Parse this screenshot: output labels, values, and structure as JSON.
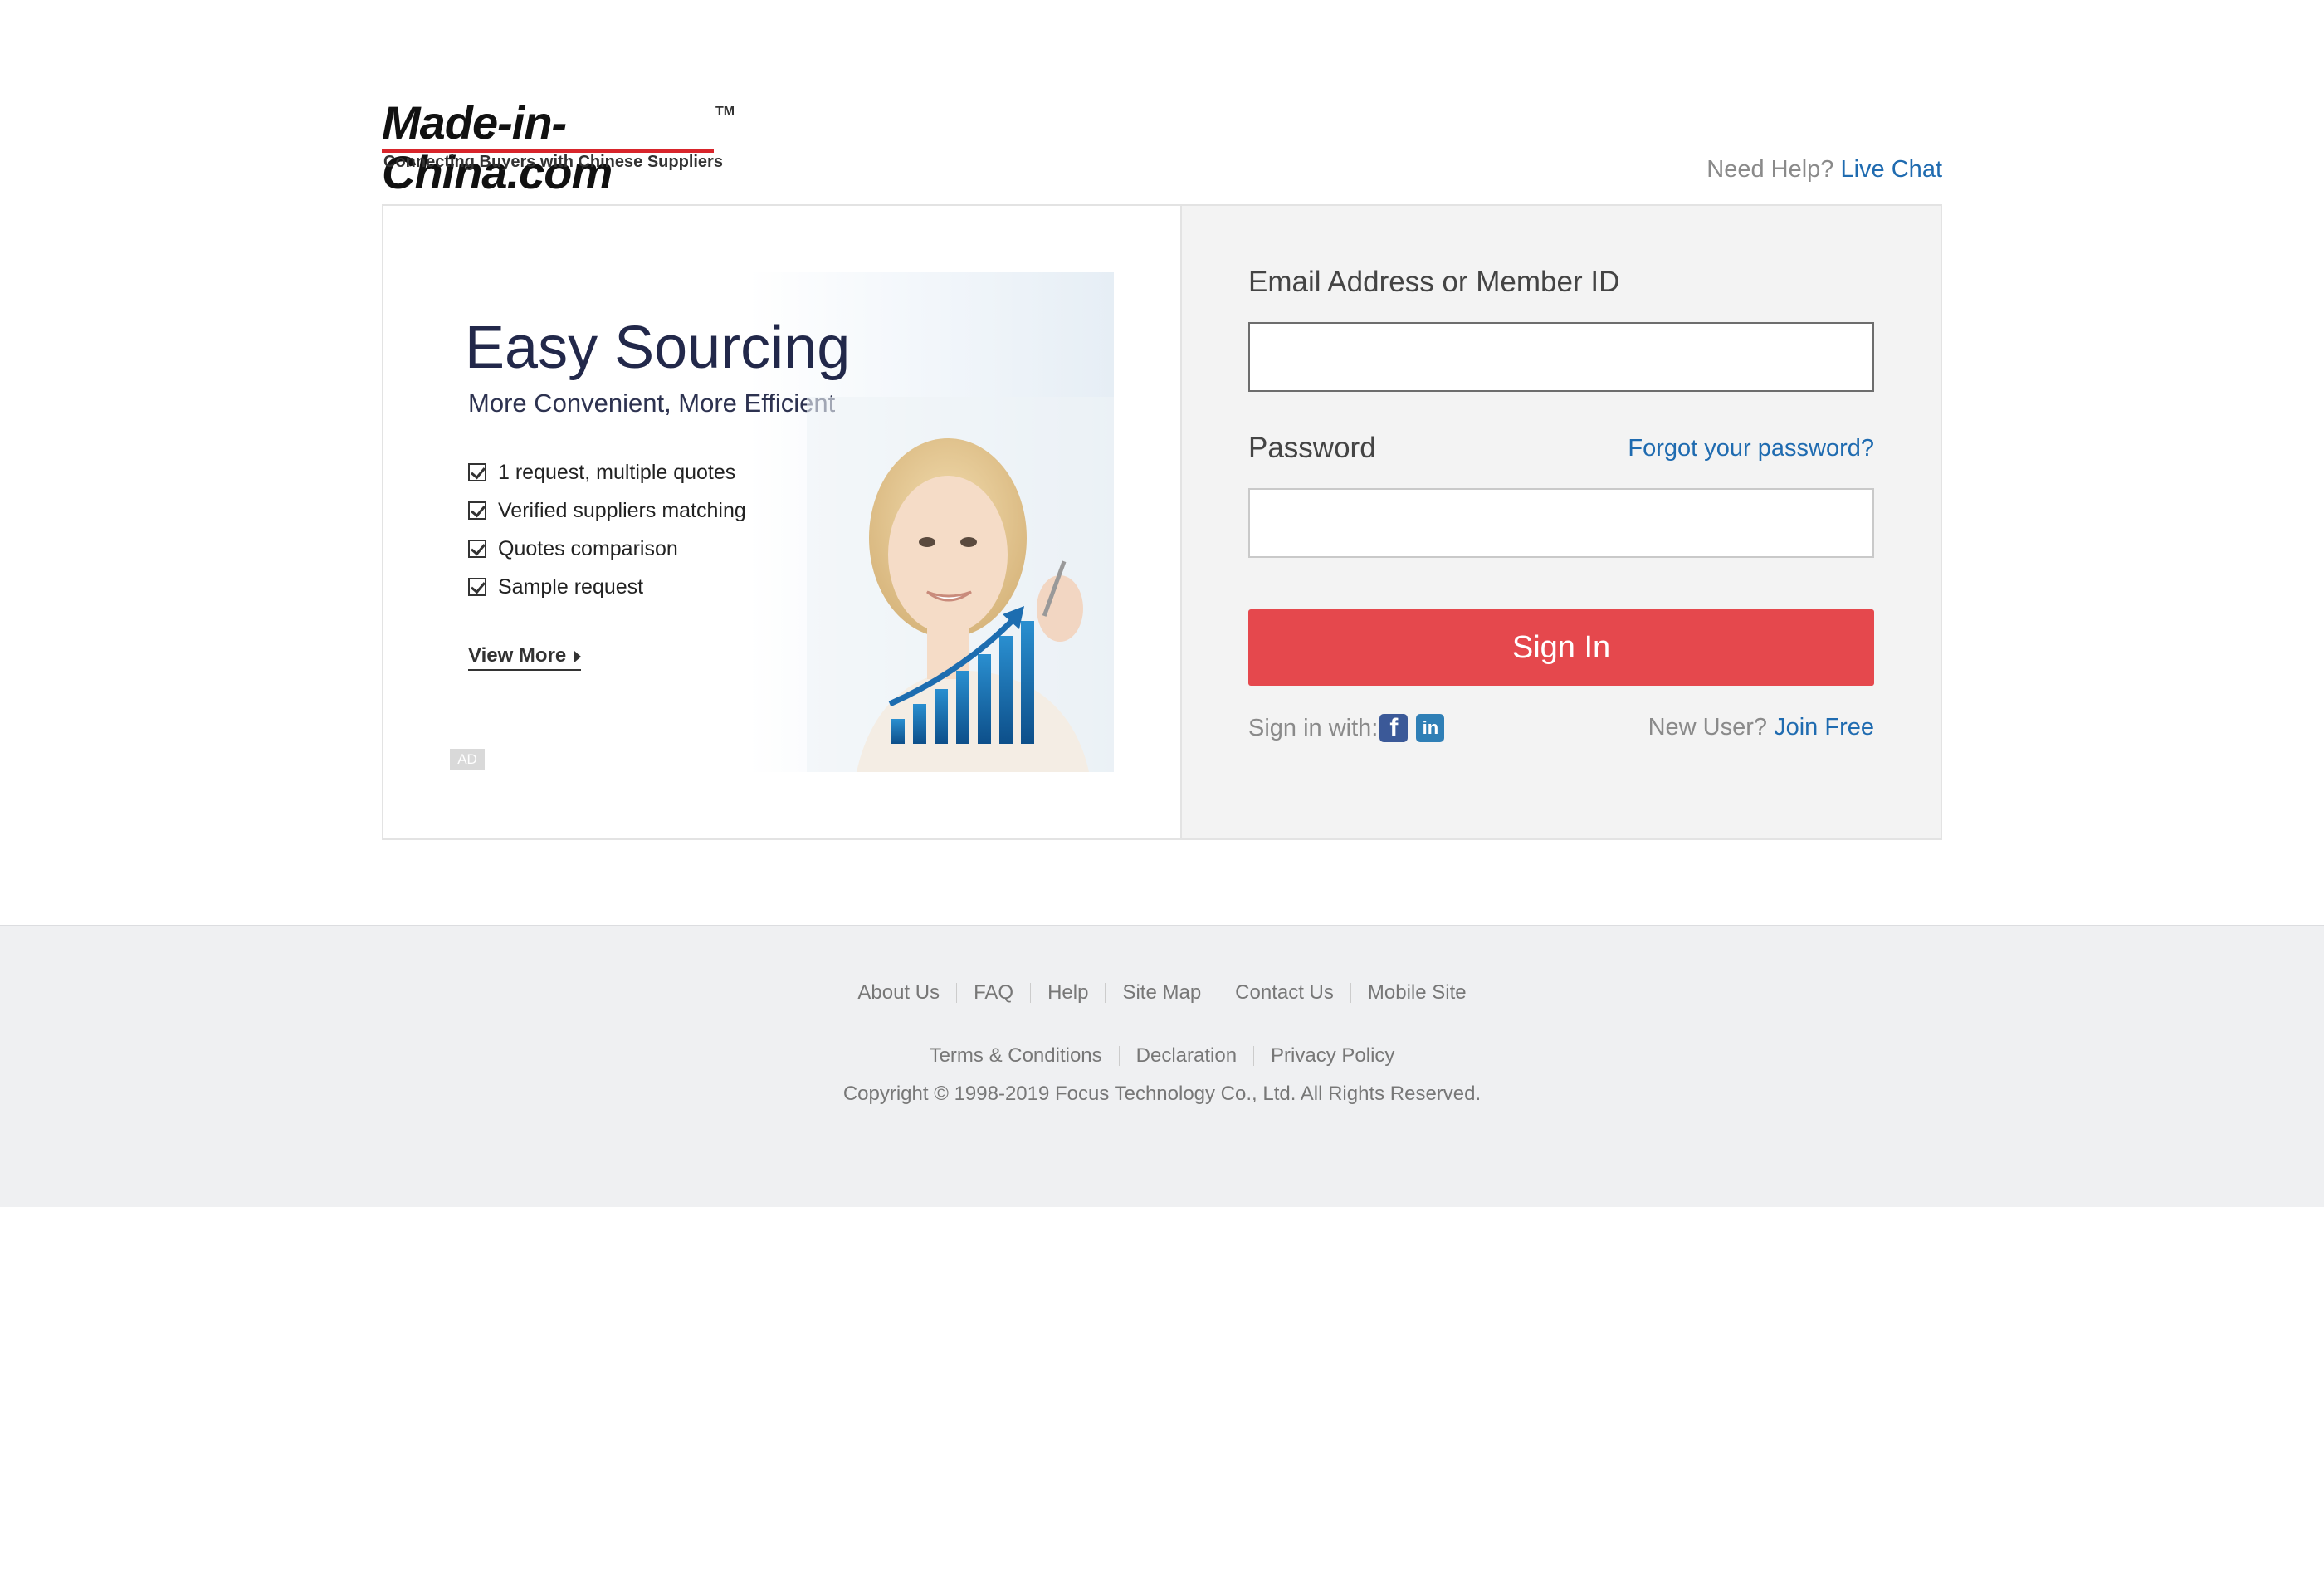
{
  "header": {
    "logo_text": "Made-in-China.com",
    "logo_tm": "TM",
    "logo_tagline": "Connecting Buyers with Chinese Suppliers",
    "need_help": "Need Help?",
    "live_chat": "Live Chat"
  },
  "ad": {
    "title": "Easy Sourcing",
    "subtitle": "More Convenient, More Efficient",
    "items": [
      "1 request, multiple quotes",
      "Verified suppliers matching",
      "Quotes comparison",
      "Sample request"
    ],
    "view_more": "View More",
    "badge": "AD"
  },
  "login": {
    "email_label": "Email Address or Member ID",
    "email_value": "",
    "password_label": "Password",
    "password_value": "",
    "forgot": "Forgot your password?",
    "sign_in": "Sign In",
    "sign_in_with": "Sign in with:",
    "social": [
      "facebook-icon",
      "linkedin-icon"
    ],
    "new_user": "New User?",
    "join_free": "Join Free"
  },
  "footer": {
    "links_row1": [
      "About Us",
      "FAQ",
      "Help",
      "Site Map",
      "Contact Us",
      "Mobile Site"
    ],
    "links_row2": [
      "Terms & Conditions",
      "Declaration",
      "Privacy Policy"
    ],
    "copyright": "Copyright © 1998-2019 Focus Technology Co., Ltd. All Rights Reserved."
  },
  "colors": {
    "accent_blue": "#1f6bb0",
    "sign_in_red": "#e5484d",
    "panel_gray": "#f3f3f3",
    "footer_bg": "#eff0f2"
  }
}
